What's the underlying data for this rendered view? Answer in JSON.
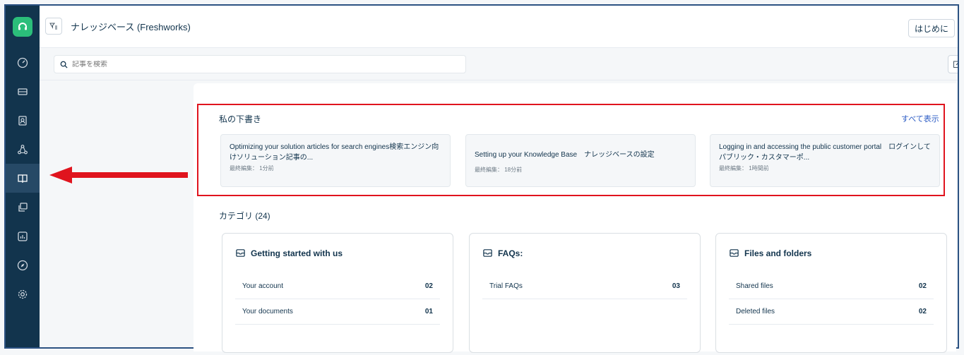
{
  "header": {
    "title": "ナレッジベース (Freshworks)",
    "start_button": "はじめに",
    "toggle_icon": "filter-icon"
  },
  "search": {
    "placeholder": "記事を検索"
  },
  "sidebar": {
    "items": [
      {
        "icon": "dashboard-icon"
      },
      {
        "icon": "ticket-icon"
      },
      {
        "icon": "contacts-icon"
      },
      {
        "icon": "social-icon"
      },
      {
        "icon": "book-icon",
        "active": true
      },
      {
        "icon": "canned-responses-icon"
      },
      {
        "icon": "reports-icon"
      },
      {
        "icon": "compass-icon"
      },
      {
        "icon": "gear-icon"
      }
    ]
  },
  "drafts": {
    "title": "私の下書き",
    "see_all": "すべて表示",
    "items": [
      {
        "title": "Optimizing your solution articles for search engines検索エンジン向けソリューション記事の...",
        "meta": "最終編集： 1分前"
      },
      {
        "title": "Setting up your Knowledge Base　ナレッジベースの設定",
        "meta": "最終編集： 18分前"
      },
      {
        "title": "Logging in and accessing the public customer portal　ログインしてパブリック・カスタマーポ...",
        "meta": "最終編集： 1時間前"
      }
    ]
  },
  "categories": {
    "heading": "カテゴリ (24)",
    "items": [
      {
        "title": "Getting started with us",
        "folders": [
          {
            "name": "Your account",
            "count": "02"
          },
          {
            "name": "Your documents",
            "count": "01"
          }
        ]
      },
      {
        "title": "FAQs:",
        "folders": [
          {
            "name": "Trial FAQs",
            "count": "03"
          }
        ]
      },
      {
        "title": "Files and folders",
        "folders": [
          {
            "name": "Shared files",
            "count": "02"
          },
          {
            "name": "Deleted files",
            "count": "02"
          }
        ]
      }
    ]
  },
  "colors": {
    "sidebar": "#12344d",
    "brand": "#2bbe7a",
    "highlight": "#e0141e",
    "link": "#2c5cc5"
  }
}
